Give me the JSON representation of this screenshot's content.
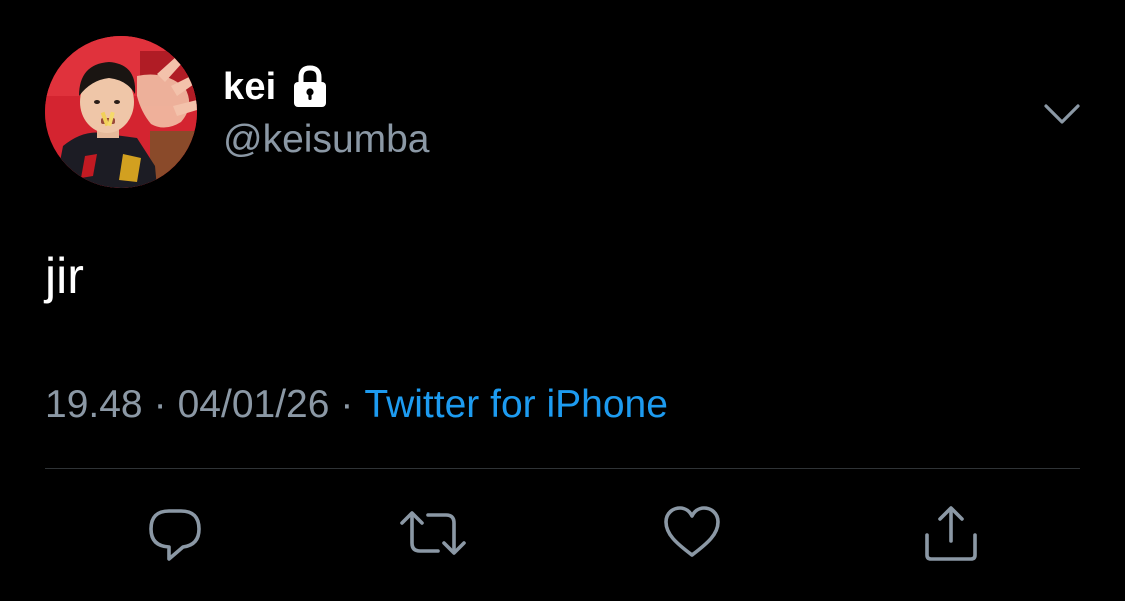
{
  "tweet": {
    "display_name": "kei",
    "handle": "@keisumba",
    "protected_icon": "lock-icon",
    "text": "jir",
    "time": "19.48",
    "separator": "·",
    "date": "04/01/26",
    "source": "Twitter for iPhone",
    "menu_icon": "chevron-down-icon"
  },
  "actions": [
    {
      "name": "reply",
      "icon": "reply-icon"
    },
    {
      "name": "retweet",
      "icon": "retweet-icon"
    },
    {
      "name": "like",
      "icon": "heart-icon"
    },
    {
      "name": "share",
      "icon": "share-icon"
    }
  ],
  "colors": {
    "background": "#000000",
    "primary_text": "#ffffff",
    "secondary_text": "#8b98a5",
    "link": "#1d9bf0",
    "divider": "#2f3336"
  }
}
